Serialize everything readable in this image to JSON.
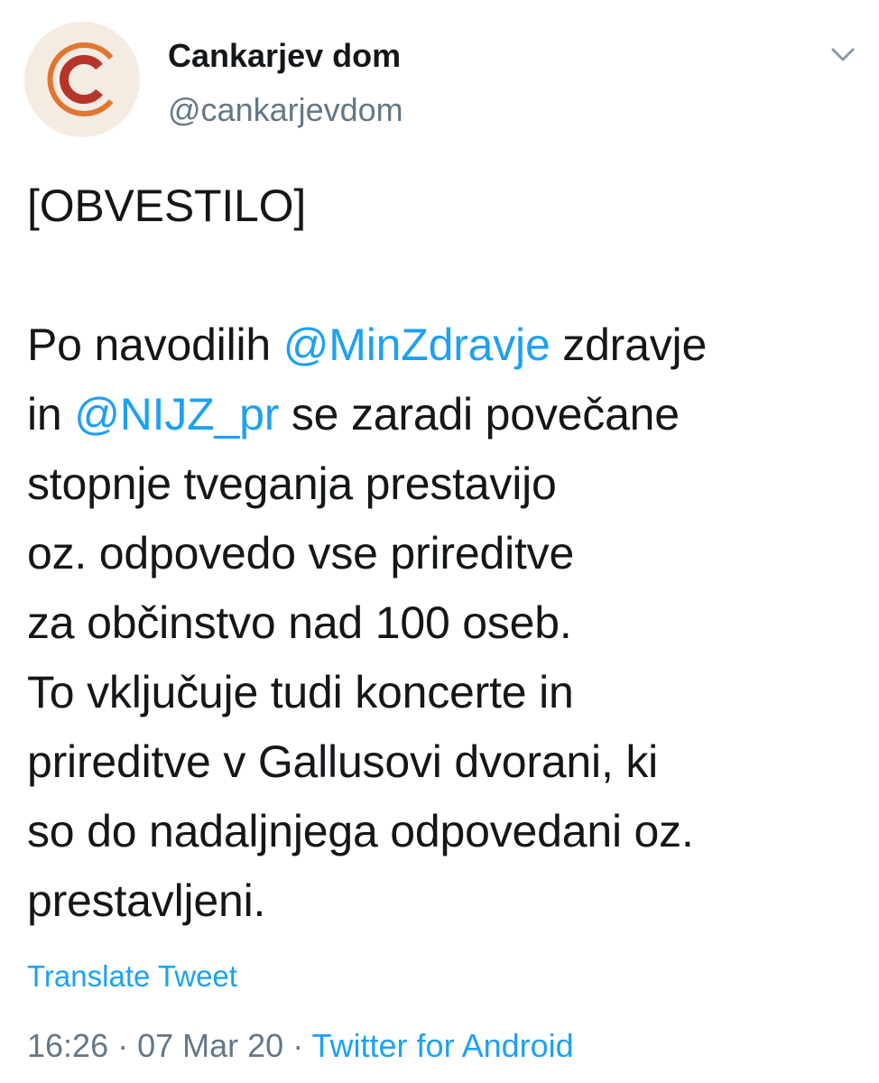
{
  "author": {
    "display_name": "Cankarjev dom",
    "handle": "@cankarjevdom",
    "avatar_icon": "cankarjev-dom-logo-icon",
    "avatar_color": "#b5352b"
  },
  "header": {
    "menu_icon": "chevron-down-icon"
  },
  "tweet": {
    "heading": "[OBVESTILO]",
    "line1_prefix": "Po navodilih ",
    "mention1": "@MinZdravje",
    "line1_suffix": " zdravje",
    "line2_prefix": "in ",
    "mention2": "@NIJZ_pr",
    "line2_suffix": " se zaradi povečane",
    "line3": "stopnje tveganja prestavijo",
    "line4": "oz. odpovedo vse prireditve",
    "line5": "za občinstvo nad 100 oseb.",
    "line6": "To vključuje tudi koncerte in",
    "line7": "prireditve v Gallusovi dvorani, ki",
    "line8": "so do nadaljnjega odpovedani oz.",
    "line9": "prestavljeni."
  },
  "actions": {
    "translate_label": "Translate Tweet"
  },
  "meta": {
    "time": "16:26",
    "separator1": " · ",
    "date": "07 Mar 20",
    "separator2": " · ",
    "source": "Twitter for Android"
  },
  "colors": {
    "link": "#1da1f2",
    "secondary_text": "#657786",
    "primary_text": "#14171a"
  }
}
